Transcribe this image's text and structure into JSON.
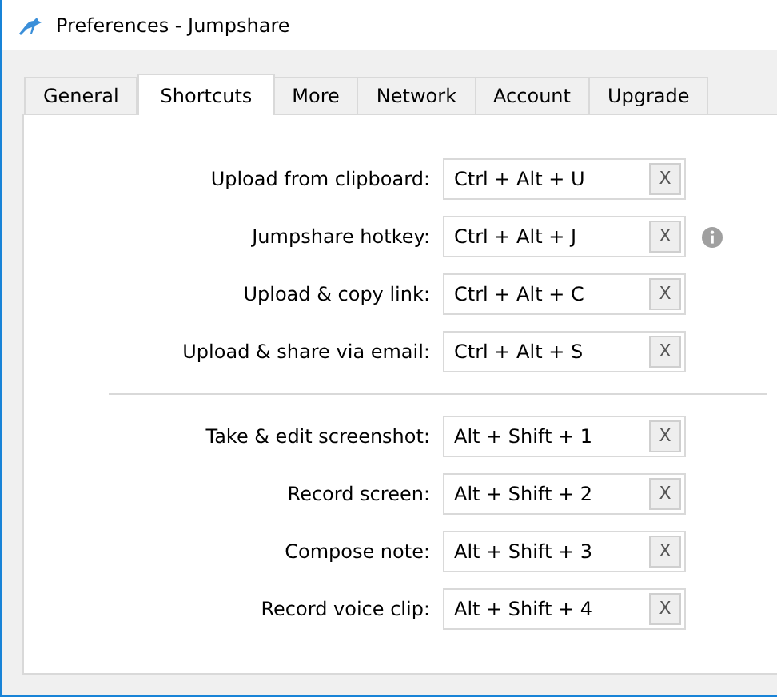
{
  "window": {
    "title": "Preferences - Jumpshare"
  },
  "tabs": [
    {
      "label": "General",
      "selected": false
    },
    {
      "label": "Shortcuts",
      "selected": true
    },
    {
      "label": "More",
      "selected": false
    },
    {
      "label": "Network",
      "selected": false
    },
    {
      "label": "Account",
      "selected": false
    },
    {
      "label": "Upgrade",
      "selected": false
    }
  ],
  "groups": [
    {
      "shortcuts": [
        {
          "label": "Upload from clipboard:",
          "value": "Ctrl + Alt + U",
          "clear": "X",
          "info_icon": false
        },
        {
          "label": "Jumpshare hotkey:",
          "value": "Ctrl + Alt + J",
          "clear": "X",
          "info_icon": true
        },
        {
          "label": "Upload & copy link:",
          "value": "Ctrl + Alt + C",
          "clear": "X",
          "info_icon": false
        },
        {
          "label": "Upload & share via email:",
          "value": "Ctrl + Alt + S",
          "clear": "X",
          "info_icon": false
        }
      ]
    },
    {
      "shortcuts": [
        {
          "label": "Take & edit screenshot:",
          "value": "Alt + Shift + 1",
          "clear": "X",
          "info_icon": false
        },
        {
          "label": "Record screen:",
          "value": "Alt + Shift + 2",
          "clear": "X",
          "info_icon": false
        },
        {
          "label": "Compose note:",
          "value": "Alt + Shift + 3",
          "clear": "X",
          "info_icon": false
        },
        {
          "label": "Record voice clip:",
          "value": "Alt + Shift + 4",
          "clear": "X",
          "info_icon": false
        }
      ]
    }
  ]
}
